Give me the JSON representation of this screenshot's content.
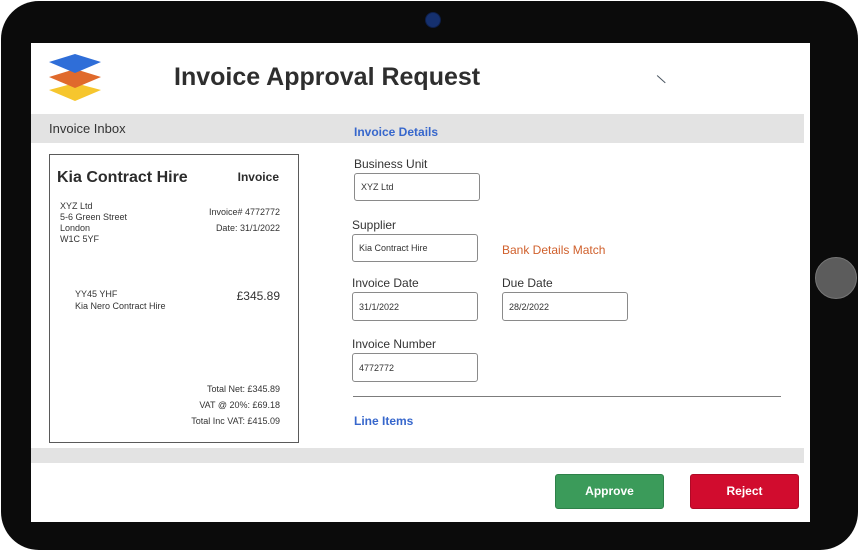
{
  "header": {
    "title": "Invoice Approval Request"
  },
  "inbox": {
    "label": "Invoice Inbox",
    "invoice": {
      "company": "Kia Contract Hire",
      "doc_type": "Invoice",
      "address": [
        "XYZ Ltd",
        "5-6 Green Street",
        "London",
        "W1C 5YF"
      ],
      "invoice_no": "Invoice# 4772772",
      "date": "Date: 31/1/2022",
      "line": {
        "ref": "YY45 YHF",
        "desc": "Kia Nero Contract Hire",
        "amount": "£345.89"
      },
      "totals": {
        "net": "Total Net: £345.89",
        "vat": "VAT @ 20%:    £69.18",
        "inc_vat": "Total Inc VAT: £415.09"
      }
    }
  },
  "details": {
    "section_title": "Invoice Details",
    "business_unit": {
      "label": "Business Unit",
      "value": "XYZ Ltd"
    },
    "supplier": {
      "label": "Supplier",
      "value": "Kia Contract Hire"
    },
    "bank_status": "Bank Details Match",
    "invoice_date": {
      "label": "Invoice Date",
      "value": "31/1/2022"
    },
    "due_date": {
      "label": "Due Date",
      "value": "28/2/2022"
    },
    "invoice_number": {
      "label": "Invoice Number",
      "value": "4772772"
    },
    "line_items_title": "Line Items"
  },
  "actions": {
    "approve": "Approve",
    "reject": "Reject"
  },
  "colors": {
    "accent": "#3767cc",
    "approve": "#3b9b5a",
    "reject": "#d10c2e",
    "status": "#d0602c"
  },
  "icons": {
    "logo": "layered-stack-logo"
  }
}
